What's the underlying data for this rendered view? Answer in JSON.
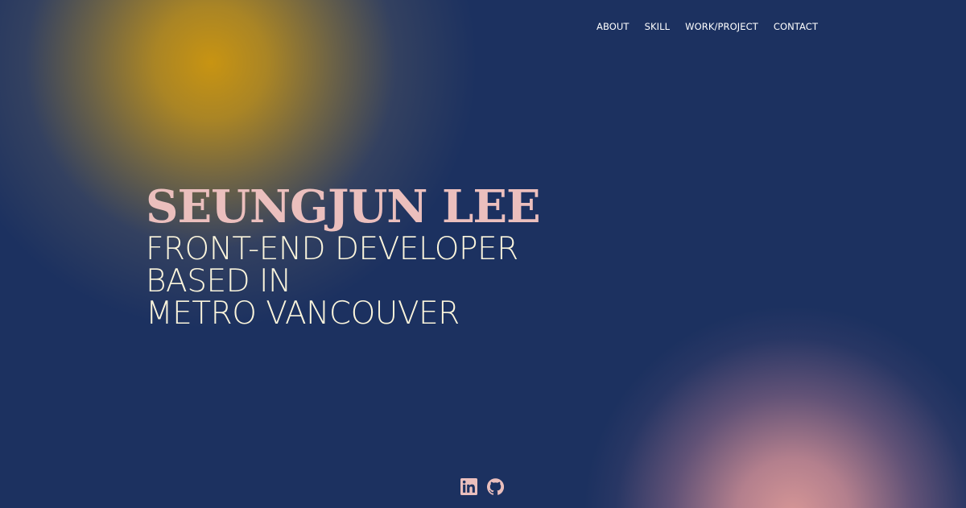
{
  "nav": {
    "items": [
      {
        "label": "ABOUT"
      },
      {
        "label": "SKILL"
      },
      {
        "label": "WORK/PROJECT"
      },
      {
        "label": "CONTACT"
      }
    ]
  },
  "hero": {
    "name": "SEUNGJUN LEE",
    "line1": "FRONT-END DEVELOPER",
    "line2": "BASED IN",
    "line3": "METRO VANCOUVER"
  },
  "socials": [
    {
      "icon": "linkedin-icon"
    },
    {
      "icon": "github-icon"
    }
  ],
  "colors": {
    "background": "#1c3160",
    "name": "#ebbfbd",
    "tagline": "#fbf5dc",
    "nav": "#ffffff",
    "icons": "#ebbfbd",
    "glow_gold": "#c89412",
    "glow_pink": "#d69696"
  }
}
